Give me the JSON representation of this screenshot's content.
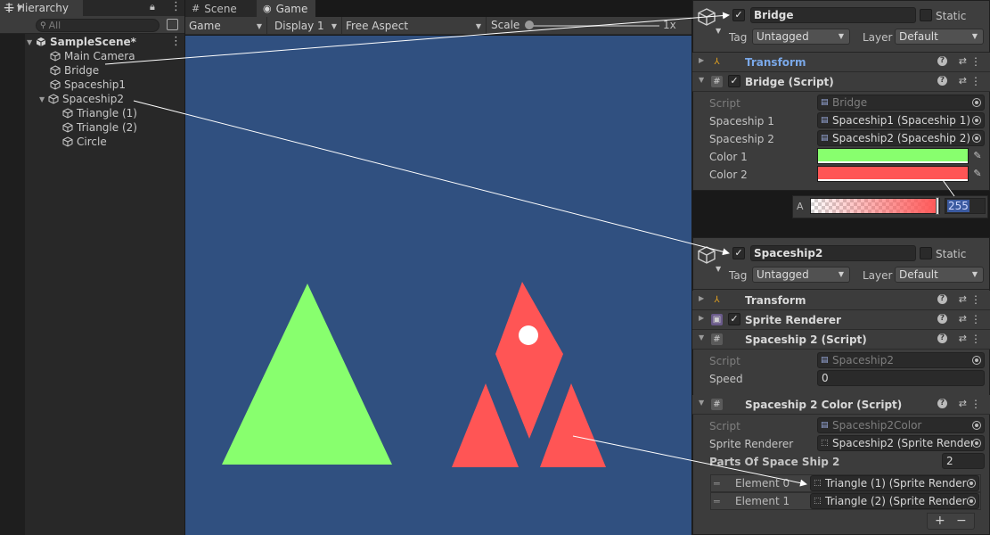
{
  "hierarchy": {
    "tab_label": "Hierarchy",
    "search_placeholder": "All",
    "scene_name": "SampleScene*",
    "items": [
      {
        "label": "Main Camera"
      },
      {
        "label": "Bridge"
      },
      {
        "label": "Spaceship1"
      },
      {
        "label": "Spaceship2"
      },
      {
        "label": "Triangle (1)"
      },
      {
        "label": "Triangle (2)"
      },
      {
        "label": "Circle"
      }
    ]
  },
  "game_view": {
    "tab_scene": "Scene",
    "tab_game": "Game",
    "view_mode": "Game",
    "display": "Display 1",
    "aspect": "Free Aspect",
    "scale_label": "Scale",
    "scale_value": "1x",
    "background_color": "#305080",
    "shapes": {
      "green_color": "#88ff6e",
      "red_color": "#ff5555",
      "white_color": "#ffffff"
    }
  },
  "inspector_bridge": {
    "object_name": "Bridge",
    "active": true,
    "static_label": "Static",
    "tag_label": "Tag",
    "tag_value": "Untagged",
    "layer_label": "Layer",
    "layer_value": "Default",
    "components": [
      {
        "title": "Transform"
      },
      {
        "title": "Bridge (Script)"
      }
    ],
    "fields": {
      "script_label": "Script",
      "script_value": "Bridge",
      "spaceship1_label": "Spaceship 1",
      "spaceship1_value": "Spaceship1 (Spaceship 1)",
      "spaceship2_label": "Spaceship 2",
      "spaceship2_value": "Spaceship2 (Spaceship 2)",
      "color1_label": "Color 1",
      "color1_value": "#88ff6e",
      "color2_label": "Color 2",
      "color2_value": "#ff5555"
    },
    "alpha_popup": {
      "label": "A",
      "value": "255"
    }
  },
  "inspector_spaceship2": {
    "object_name": "Spaceship2",
    "active": true,
    "static_label": "Static",
    "tag_label": "Tag",
    "tag_value": "Untagged",
    "layer_label": "Layer",
    "layer_value": "Default",
    "components": [
      {
        "title": "Transform"
      },
      {
        "title": "Sprite Renderer"
      },
      {
        "title": "Spaceship 2 (Script)"
      },
      {
        "title": "Spaceship 2 Color (Script)"
      }
    ],
    "ss2_script": {
      "script_label": "Script",
      "script_value": "Spaceship2",
      "speed_label": "Speed",
      "speed_value": "0"
    },
    "ss2_color_script": {
      "script_label": "Script",
      "script_value": "Spaceship2Color",
      "renderer_label": "Sprite Renderer",
      "renderer_value": "Spaceship2 (Sprite Rendere",
      "parts_label": "Parts Of Space Ship 2",
      "parts_count": "2",
      "elements": [
        {
          "label": "Element 0",
          "value": "Triangle (1) (Sprite Rendere"
        },
        {
          "label": "Element 1",
          "value": "Triangle (2) (Sprite Rendere"
        }
      ],
      "add_label": "+",
      "remove_label": "−"
    }
  }
}
